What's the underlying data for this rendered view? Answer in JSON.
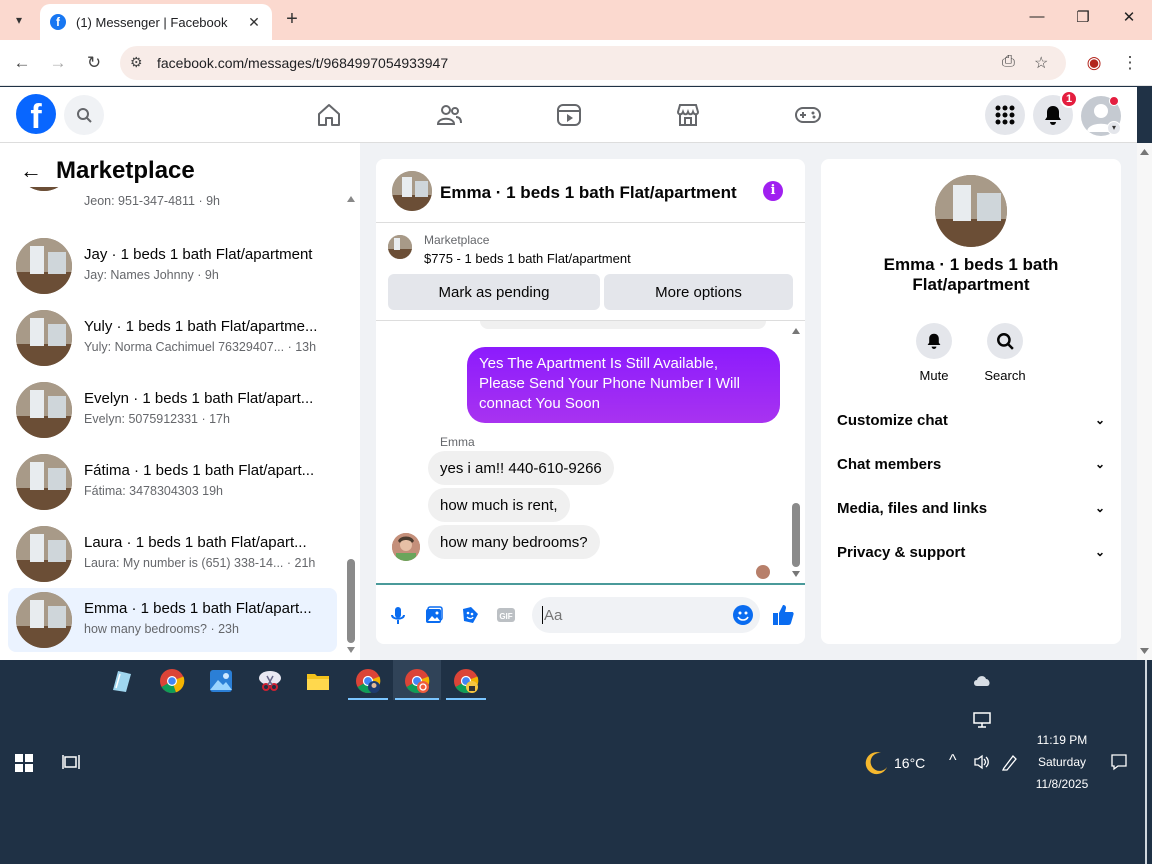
{
  "browser": {
    "tab_title": "(1) Messenger | Facebook",
    "url": "facebook.com/messages/t/9684997054933947"
  },
  "fb_header": {
    "notification_count": "1"
  },
  "sidebar": {
    "title": "Marketplace",
    "conversations": [
      {
        "name": "",
        "preview": "Jeon: 951-347-4811 · 9h"
      },
      {
        "name": "Jay · 1 beds 1 bath Flat/apartment",
        "preview": "Jay: Names Johnny · 9h"
      },
      {
        "name": "Yuly · 1 beds 1 bath Flat/apartme...",
        "preview": "Yuly: Norma Cachimuel 76329407... · 13h"
      },
      {
        "name": "Evelyn · 1 beds 1 bath Flat/apart...",
        "preview": "Evelyn: 5075912331 · 17h"
      },
      {
        "name": "Fátima · 1 beds 1 bath Flat/apart...",
        "preview": "Fátima: 3478304303 19h"
      },
      {
        "name": "Laura · 1 beds 1 bath Flat/apart...",
        "preview": "Laura: My number is (651) 338-14... · 21h"
      },
      {
        "name": "Emma · 1 beds 1 bath Flat/apart...",
        "preview": "how many bedrooms? · 23h"
      }
    ]
  },
  "chat": {
    "title": "Emma · 1 beds 1 bath Flat/apartment",
    "listing_label": "Marketplace",
    "listing_title": "$775 - 1 beds 1 bath Flat/apartment",
    "mark_pending_label": "Mark as pending",
    "more_options_label": "More options",
    "outgoing": "Yes The Apartment Is Still Available, Please Send Your Phone Number I Will connact You Soon",
    "sender": "Emma",
    "incoming": [
      "yes i am!! 440-610-9266",
      "how much is rent,",
      "how many bedrooms?"
    ],
    "input_placeholder": "Aa"
  },
  "details": {
    "name": "Emma · 1 beds 1 bath Flat/apartment",
    "mute_label": "Mute",
    "search_label": "Search",
    "sections": [
      "Customize chat",
      "Chat members",
      "Media, files and links",
      "Privacy & support"
    ]
  },
  "taskbar": {
    "weather": "16°C",
    "time": "11:19 PM",
    "day": "Saturday",
    "date": "11/8/2025"
  },
  "colors": {
    "fb_blue": "#0866ff",
    "accent_purple": "#a020f0",
    "notification_red": "#e41e3f"
  }
}
